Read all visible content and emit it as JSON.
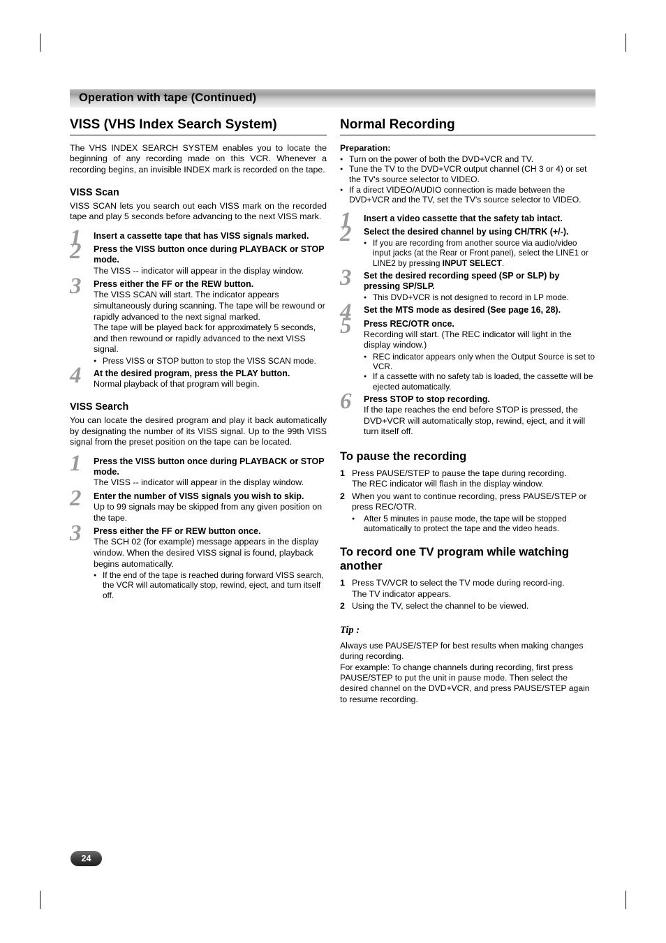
{
  "page": {
    "number": "24",
    "banner_title": "Operation with tape (Continued)"
  },
  "left": {
    "section_title": "VISS (VHS Index Search System)",
    "intro": "The VHS INDEX SEARCH SYSTEM enables you to locate the beginning of any recording made on this VCR. Whenever a recording begins, an invisible INDEX mark is recorded on the tape.",
    "viss_scan": {
      "title": "VISS Scan",
      "intro": "VISS SCAN lets you search out each VISS mark on the recorded tape and play 5 seconds before advancing to the next VISS mark.",
      "steps": [
        {
          "num": "1",
          "head": "Insert a cassette tape that has VISS signals marked.",
          "texts": [],
          "bullets": []
        },
        {
          "num": "2",
          "head": "Press the VISS button once during PLAYBACK or STOP mode.",
          "texts": [
            "The VISS -- indicator will appear in the display window."
          ],
          "bullets": []
        },
        {
          "num": "3",
          "head": "Press either the FF or the REW button.",
          "texts": [
            "The VISS SCAN will start. The indicator appears simultaneously during scanning. The tape will be rewound or rapidly advanced to the next signal marked.",
            "The tape will be played back for approximately 5 seconds, and then rewound or rapidly advanced to the next VISS signal."
          ],
          "bullets": [
            "Press VISS or STOP button to stop the VISS SCAN mode."
          ]
        },
        {
          "num": "4",
          "head": "At the desired program, press the PLAY button.",
          "texts": [
            "Normal playback of that program will begin."
          ],
          "bullets": []
        }
      ]
    },
    "viss_search": {
      "title": "VISS Search",
      "intro": "You can locate the desired program and play it back automatically by designating the number of its VISS signal. Up to the 99th VISS signal from the preset position on the tape can be located.",
      "steps": [
        {
          "num": "1",
          "head": "Press the VISS button once during PLAYBACK or STOP mode.",
          "texts": [
            "The VISS -- indicator will appear in the display window."
          ],
          "bullets": []
        },
        {
          "num": "2",
          "head": "Enter the number of VISS signals you wish to skip.",
          "texts": [
            "Up to 99 signals may be skipped from any given position on the tape."
          ],
          "bullets": []
        },
        {
          "num": "3",
          "head": "Press either the FF or REW button once.",
          "texts": [
            "The SCH 02 (for example) message appears in the display window. When the desired VISS signal is found, playback begins automatically."
          ],
          "bullets": [
            "If the end of the tape is reached during forward VISS search, the VCR will automatically stop, rewind, eject, and turn itself off."
          ]
        }
      ]
    }
  },
  "right": {
    "section_title": "Normal Recording",
    "preparation_label": "Preparation:",
    "preparation_bullets": [
      "Turn on the power of both the DVD+VCR and TV.",
      "Tune the TV to the DVD+VCR output channel (CH 3 or 4) or set the TV's source selector to VIDEO.",
      "If a direct VIDEO/AUDIO connection is made between the DVD+VCR and the TV, set the TV's source selector to VIDEO."
    ],
    "steps": [
      {
        "num": "1",
        "head": "Insert a video cassette that the safety tab intact.",
        "texts": [],
        "bullets": []
      },
      {
        "num": "2",
        "head": "Select the desired channel by using CH/TRK (+/-).",
        "texts": [],
        "bullets": [
          "If you are recording from another source via audio/video input jacks (at the Rear or Front panel), select the LINE1 or LINE2 by pressing <b>INPUT SELECT</b>."
        ]
      },
      {
        "num": "3",
        "head": "Set the desired recording speed (SP or SLP) by pressing SP/SLP.",
        "texts": [],
        "bullets": [
          "This DVD+VCR is not designed to record in LP mode."
        ]
      },
      {
        "num": "4",
        "head": "Set the MTS mode as desired (See page 16, 28).",
        "texts": [],
        "bullets": []
      },
      {
        "num": "5",
        "head": "Press REC/OTR once.",
        "texts": [
          "Recording will start. (The REC indicator will light in the display window.)"
        ],
        "bullets": [
          "REC indicator appears only when the Output Source is set to VCR.",
          "If a cassette with no safety tab is loaded, the cassette will be ejected automatically."
        ]
      },
      {
        "num": "6",
        "head": "Press STOP to stop recording.",
        "texts": [
          "If the tape reaches the end before STOP  is pressed, the DVD+VCR will automatically stop, rewind, eject, and it will turn itself off."
        ],
        "bullets": []
      }
    ],
    "pause_section": {
      "title": "To pause the recording",
      "items": [
        {
          "n": "1",
          "text": "Press PAUSE/STEP to pause the tape during recording.",
          "sub": "The REC indicator will flash in the display window.",
          "bullets": []
        },
        {
          "n": "2",
          "text": "When you want to continue recording, press PAUSE/STEP or press REC/OTR.",
          "sub": "",
          "bullets": [
            "After 5 minutes in pause mode, the tape will be stopped automatically to protect the tape and the video heads."
          ]
        }
      ]
    },
    "record_section": {
      "title": "To record one TV program while watching another",
      "items": [
        {
          "n": "1",
          "text": "Press TV/VCR to select the TV mode during record-ing.",
          "sub": "The TV indicator appears.",
          "bullets": []
        },
        {
          "n": "2",
          "text": "Using the TV, select the channel to be viewed.",
          "sub": "",
          "bullets": []
        }
      ]
    },
    "tip": {
      "label": "Tip :",
      "paragraphs": [
        "Always use PAUSE/STEP for best results when making changes during recording.",
        "For example: To change channels during recording, first press PAUSE/STEP to put the unit in pause mode. Then select the desired channel on the DVD+VCR, and press PAUSE/STEP again to resume recording."
      ]
    }
  }
}
